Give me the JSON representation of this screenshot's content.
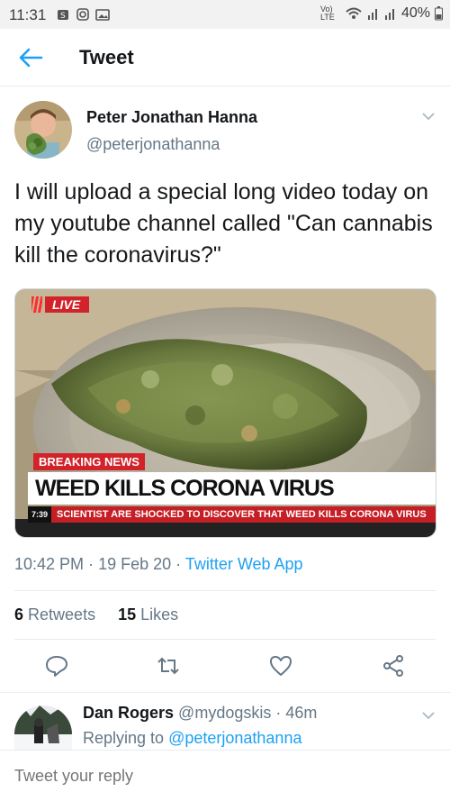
{
  "status_bar": {
    "time": "11:31",
    "network_label": "Vo) LTE",
    "battery": "40%"
  },
  "app_bar": {
    "title": "Tweet"
  },
  "tweet": {
    "author_name": "Peter Jonathan Hanna",
    "author_handle": "@peterjonathanna",
    "text": "I will upload a special long video today on my youtube channel called \"Can cannabis kill the coronavirus?\"",
    "media": {
      "live_label": "LIVE",
      "breaking_label": "BREAKING NEWS",
      "headline": "WEED KILLS CORONA VIRUS",
      "ticker_time": "7:39",
      "ticker_text": "SCIENTIST ARE SHOCKED TO DISCOVER THAT WEED KILLS CORONA VIRUS"
    },
    "time": "10:42 PM",
    "sep1": "·",
    "date": "19 Feb 20",
    "sep2": "·",
    "source": "Twitter Web App",
    "retweets_count": "6",
    "retweets_label": "Retweets",
    "likes_count": "15",
    "likes_label": "Likes"
  },
  "reply": {
    "author_name": "Dan Rogers",
    "author_handle": "@mydogskis",
    "sep": "·",
    "age": "46m",
    "replying_to_label": "Replying to",
    "replying_to_handle": "@peterjonathanna"
  },
  "compose": {
    "placeholder": "Tweet your reply"
  },
  "colors": {
    "accent": "#1da1f2",
    "muted": "#657786",
    "news_red": "#d2232a"
  },
  "icons": [
    "back-arrow-icon",
    "chevron-down-icon",
    "reply-icon",
    "retweet-icon",
    "like-icon",
    "share-icon"
  ]
}
